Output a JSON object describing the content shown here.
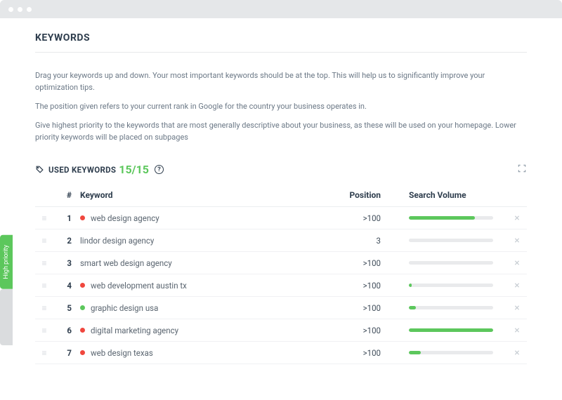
{
  "page": {
    "title": "KEYWORDS",
    "intro": [
      "Drag your keywords up and down. Your most important keywords should be at the top. This will help us to significantly improve your optimization tips.",
      "The position given refers to your current rank in Google for the country your business operates in.",
      "Give highest priority to the keywords that are most generally descriptive about your business, as these will be used on your homepage. Lower priority keywords will be placed on subpages"
    ]
  },
  "section": {
    "label": "USED KEYWORDS",
    "count": "15/15"
  },
  "columns": {
    "num": "#",
    "keyword": "Keyword",
    "position": "Position",
    "volume": "Search Volume"
  },
  "rows": [
    {
      "n": "1",
      "status": "red",
      "keyword": "web design agency",
      "position": ">100",
      "volume": 78
    },
    {
      "n": "2",
      "status": "",
      "keyword": "lindor design agency",
      "position": "3",
      "volume": 0
    },
    {
      "n": "3",
      "status": "",
      "keyword": "smart web design agency",
      "position": ">100",
      "volume": 0
    },
    {
      "n": "4",
      "status": "red",
      "keyword": "web development austin tx",
      "position": ">100",
      "volume": 3
    },
    {
      "n": "5",
      "status": "green",
      "keyword": "graphic design usa",
      "position": ">100",
      "volume": 8
    },
    {
      "n": "6",
      "status": "red",
      "keyword": "digital marketing agency",
      "position": ">100",
      "volume": 100
    },
    {
      "n": "7",
      "status": "red",
      "keyword": "web design texas",
      "position": ">100",
      "volume": 14
    }
  ],
  "sideTab": {
    "high": "High priority"
  }
}
